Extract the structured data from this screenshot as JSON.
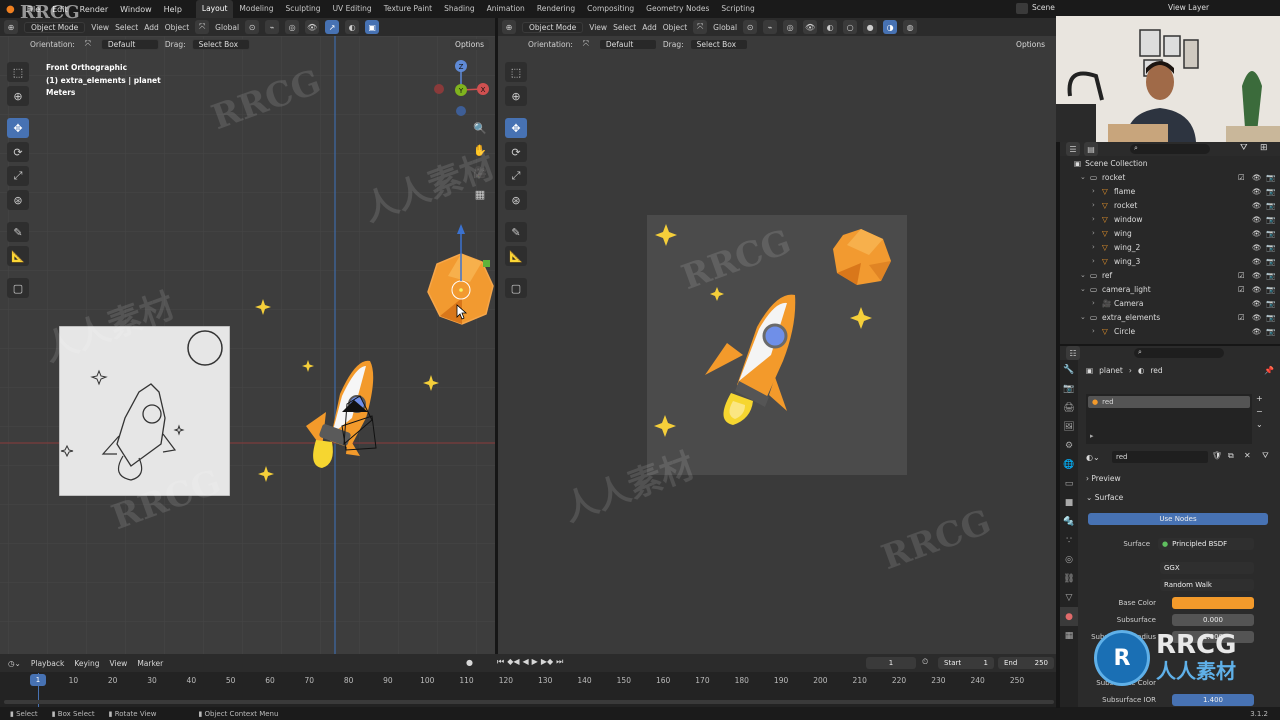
{
  "top_menu": [
    "File",
    "Edit",
    "Render",
    "Window",
    "Help"
  ],
  "workspaces": [
    {
      "label": "Layout",
      "active": true
    },
    {
      "label": "Modeling"
    },
    {
      "label": "Sculpting"
    },
    {
      "label": "UV Editing"
    },
    {
      "label": "Texture Paint"
    },
    {
      "label": "Shading"
    },
    {
      "label": "Animation"
    },
    {
      "label": "Rendering"
    },
    {
      "label": "Compositing"
    },
    {
      "label": "Geometry Nodes"
    },
    {
      "label": "Scripting"
    }
  ],
  "scene_label": "Scene",
  "view_layer_label": "View Layer",
  "left_view": {
    "mode": "Object Mode",
    "menus": [
      "View",
      "Select",
      "Add",
      "Object"
    ],
    "transform": "Global",
    "orientation_label": "Orientation:",
    "orientation_value": "Default",
    "drag_label": "Drag:",
    "drag_value": "Select Box",
    "options": "Options",
    "overlay_line1": "Front Orthographic",
    "overlay_line2": "(1) extra_elements | planet",
    "overlay_line3": "Meters",
    "gizmo_z": "Z",
    "gizmo_y": "Y",
    "gizmo_x": "X"
  },
  "right_view": {
    "mode": "Object Mode",
    "menus": [
      "View",
      "Select",
      "Add",
      "Object"
    ],
    "transform": "Global",
    "orientation_label": "Orientation:",
    "orientation_value": "Default",
    "drag_label": "Drag:",
    "drag_value": "Select Box",
    "options": "Options"
  },
  "outliner": {
    "root": "Scene Collection",
    "rows": [
      {
        "label": "rocket",
        "indent": 1,
        "type": "collection"
      },
      {
        "label": "flame",
        "indent": 2,
        "type": "object"
      },
      {
        "label": "rocket",
        "indent": 2,
        "type": "object"
      },
      {
        "label": "window",
        "indent": 2,
        "type": "object"
      },
      {
        "label": "wing",
        "indent": 2,
        "type": "object"
      },
      {
        "label": "wing_2",
        "indent": 2,
        "type": "object"
      },
      {
        "label": "wing_3",
        "indent": 2,
        "type": "object"
      },
      {
        "label": "ref",
        "indent": 1,
        "type": "collection"
      },
      {
        "label": "camera_light",
        "indent": 1,
        "type": "collection"
      },
      {
        "label": "Camera",
        "indent": 2,
        "type": "camera"
      },
      {
        "label": "extra_elements",
        "indent": 1,
        "type": "collection"
      },
      {
        "label": "Circle",
        "indent": 2,
        "type": "object"
      }
    ]
  },
  "properties": {
    "breadcrumb_object": "planet",
    "breadcrumb_material": "red",
    "slot_name": "red",
    "material_name": "red",
    "preview_label": "Preview",
    "surface_section": "Surface",
    "use_nodes": "Use Nodes",
    "surface_label": "Surface",
    "surface_value": "Principled BSDF",
    "distribution": "GGX",
    "subsurface_method": "Random Walk",
    "base_color_label": "Base Color",
    "base_color": "#f39a2b",
    "subsurface_label": "Subsurface",
    "subsurface_value": "0.000",
    "subsurface_radius_label": "Subsurface Radius",
    "subsurface_radius_value": "1.000",
    "subsurface_color_label": "Subsurface Color",
    "subsurface_ior_label": "Subsurface IOR",
    "subsurface_ior_value": "1.400"
  },
  "timeline": {
    "menus": [
      "Playback",
      "Keying",
      "View",
      "Marker"
    ],
    "current_frame": "1",
    "start_label": "Start",
    "start_value": "1",
    "end_label": "End",
    "end_value": "250",
    "ticks": [
      "1",
      "10",
      "20",
      "30",
      "40",
      "50",
      "60",
      "70",
      "80",
      "90",
      "100",
      "110",
      "120",
      "130",
      "140",
      "150",
      "160",
      "170",
      "180",
      "190",
      "200",
      "210",
      "220",
      "230",
      "240",
      "250"
    ]
  },
  "status": {
    "select": "Select",
    "box_select": "Box Select",
    "rotate_view": "Rotate View",
    "context_menu": "Object Context Menu",
    "version": "3.1.2"
  },
  "watermarks": {
    "rrcg": "RRCG",
    "cn": "人人素材"
  }
}
